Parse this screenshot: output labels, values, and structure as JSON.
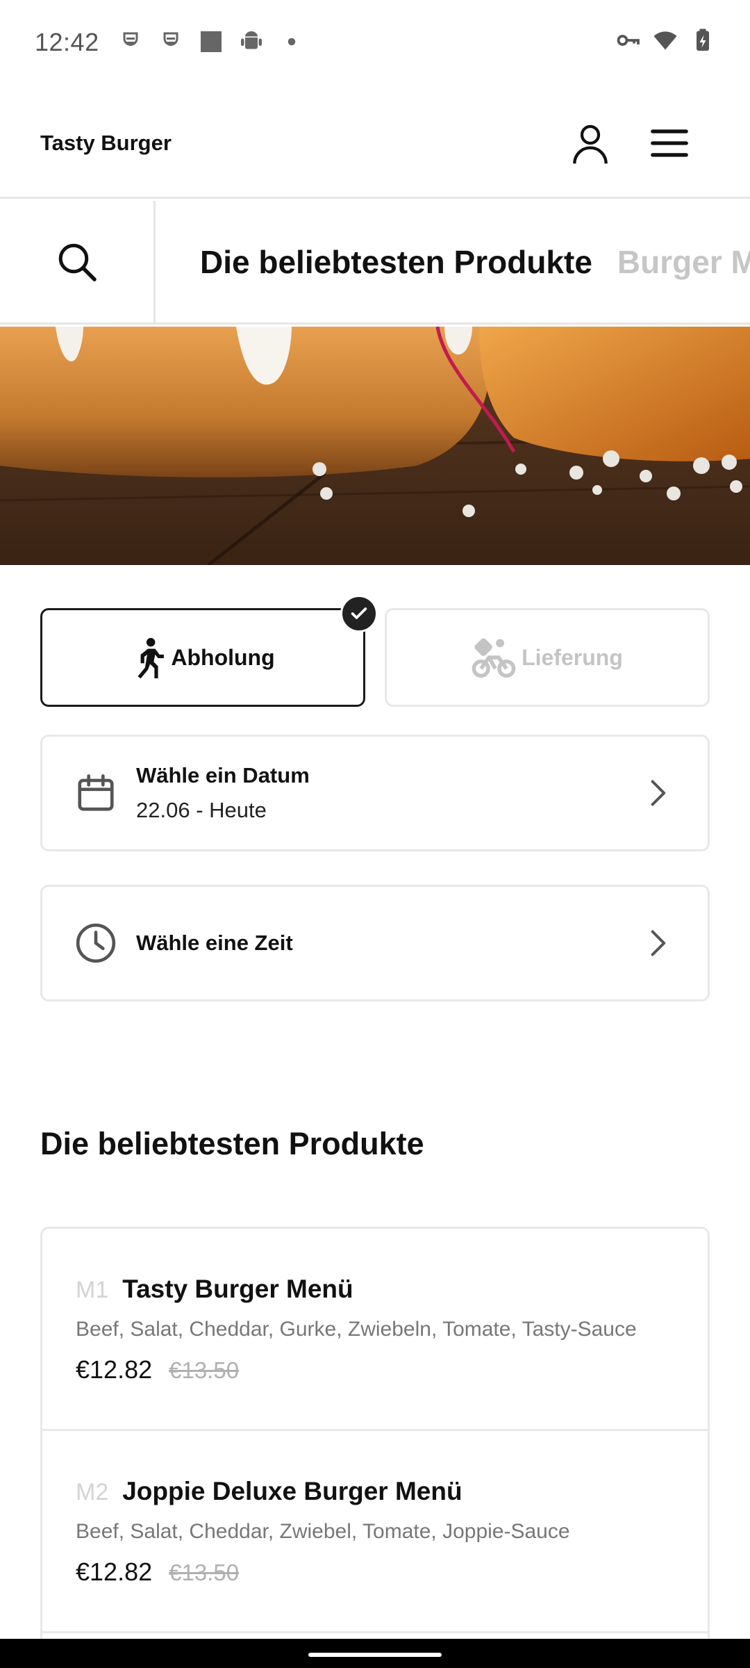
{
  "status_bar": {
    "time": "12:42",
    "left_icons": [
      "notification-face-icon",
      "notification-face-icon",
      "square-app-icon",
      "android-icon",
      "dot-icon"
    ],
    "right_icons": [
      "vpn-key-icon",
      "wifi-icon",
      "battery-charging-icon"
    ]
  },
  "header": {
    "brand": "Tasty Burger",
    "icons": [
      "user-icon",
      "hamburger-menu-icon"
    ]
  },
  "category_nav": {
    "search_icon": "search-icon",
    "tabs": [
      {
        "label": "Die beliebtesten Produkte",
        "active": true
      },
      {
        "label": "Burger Menüs",
        "active": false
      }
    ]
  },
  "order_mode": {
    "pickup": {
      "label": "Abholung",
      "icon": "walking-person-icon",
      "selected": true
    },
    "delivery": {
      "label": "Lieferung",
      "icon": "bicycle-rider-icon",
      "selected": false
    }
  },
  "date_picker": {
    "title": "Wähle ein Datum",
    "value": "22.06 - Heute"
  },
  "time_picker": {
    "title": "Wähle eine Zeit"
  },
  "section": {
    "title": "Die beliebtesten Produkte"
  },
  "products": [
    {
      "code": "M1",
      "name": "Tasty Burger Menü",
      "description": "Beef, Salat, Cheddar, Gurke, Zwiebeln, Tomate, Tasty-Sauce",
      "price": "€12.82",
      "old_price": "€13.50"
    },
    {
      "code": "M2",
      "name": "Joppie Deluxe Burger Menü",
      "description": "Beef, Salat, Cheddar, Zwiebel, Tomate, Joppie-Sauce",
      "price": "€12.82",
      "old_price": "€13.50"
    }
  ],
  "colors": {
    "primary_text": "#111111",
    "border": "#e8e8e8",
    "inactive": "#c4c4c4",
    "badge": "#222222"
  }
}
